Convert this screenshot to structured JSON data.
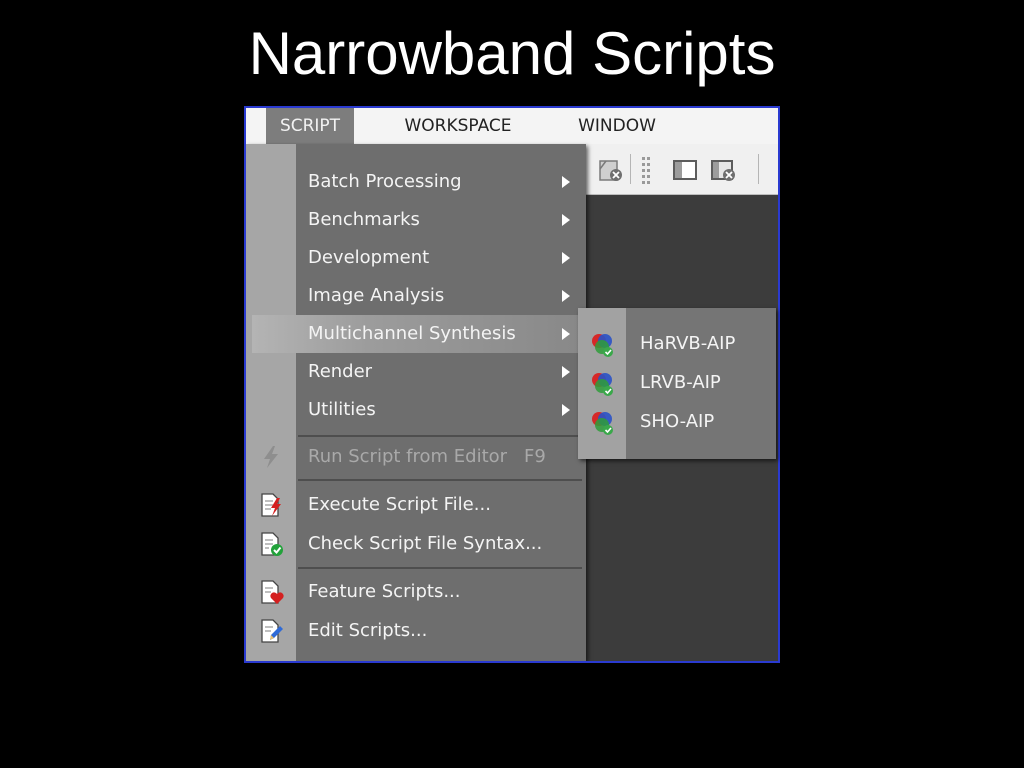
{
  "slide": {
    "title": "Narrowband Scripts"
  },
  "menubar": {
    "items": [
      "SCRIPT",
      "WORKSPACE",
      "WINDOW"
    ]
  },
  "toolbar": {
    "icons": [
      "close-image-icon",
      "grip-icon",
      "panel-icon",
      "close-panel-icon"
    ]
  },
  "script_menu": {
    "categories": [
      {
        "label": "Batch Processing",
        "has_submenu": true
      },
      {
        "label": "Benchmarks",
        "has_submenu": true
      },
      {
        "label": "Development",
        "has_submenu": true
      },
      {
        "label": "Image Analysis",
        "has_submenu": true
      },
      {
        "label": "Multichannel Synthesis",
        "has_submenu": true,
        "highlighted": true
      },
      {
        "label": "Render",
        "has_submenu": true
      },
      {
        "label": "Utilities",
        "has_submenu": true
      }
    ],
    "run_from_editor": {
      "label": "Run Script from Editor",
      "shortcut": "F9",
      "enabled": false,
      "icon": "lightning-icon"
    },
    "execute_file": {
      "label": "Execute Script File...",
      "icon": "execute-script-icon"
    },
    "check_syntax": {
      "label": "Check Script File Syntax...",
      "icon": "check-syntax-icon"
    },
    "feature_scripts": {
      "label": "Feature Scripts...",
      "icon": "feature-scripts-icon"
    },
    "edit_scripts": {
      "label": "Edit Scripts...",
      "icon": "edit-scripts-icon"
    }
  },
  "submenu": {
    "parent": "Multichannel Synthesis",
    "items": [
      {
        "label": "HaRVB-AIP",
        "icon": "rgb-channels-icon"
      },
      {
        "label": "LRVB-AIP",
        "icon": "rgb-channels-icon"
      },
      {
        "label": "SHO-AIP",
        "icon": "rgb-channels-icon"
      }
    ]
  },
  "colors": {
    "window_border": "#2a3ad0",
    "menu_bg": "#6e6e6e",
    "gutter": "#a6a6a6",
    "workspace": "#3c3c3c"
  }
}
